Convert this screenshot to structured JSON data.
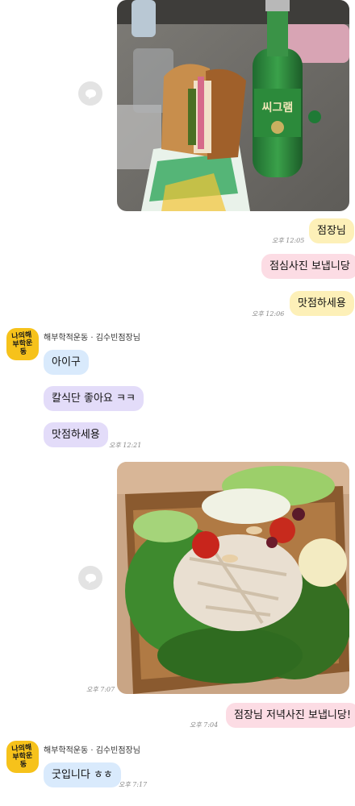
{
  "colors": {
    "bubble_yellow": "#fdf0b8",
    "bubble_pink": "#fcdce4",
    "bubble_blue": "#d9eafc",
    "bubble_purple": "#e3dcf9",
    "avatar_bg": "#f6c21b"
  },
  "messages": {
    "m1": {
      "text": "점장님",
      "time": "오후 12:05"
    },
    "m2": {
      "text": "점심사진 보냅니당"
    },
    "m3": {
      "text": "맛점하세용",
      "time": "오후 12:06"
    },
    "sender": {
      "name": "해부학적운동 · 김수빈점장님",
      "avatar_text": "나의해부학운동"
    },
    "r1": {
      "text": "아이구"
    },
    "r2": {
      "text": "칼식단 좋아요 ㅋㅋ"
    },
    "r3": {
      "text": "맛점하세용",
      "time": "오후 12:21"
    },
    "photo2": {
      "time": "오후 7:07"
    },
    "m4": {
      "text": "점장님 저녁사진 보냅니당!",
      "time": "오후 7:04"
    },
    "r4": {
      "text": "굿입니다 ㅎㅎ",
      "time": "오후 7:17"
    }
  },
  "icons": {
    "share1": "share-icon",
    "share2": "share-icon"
  }
}
